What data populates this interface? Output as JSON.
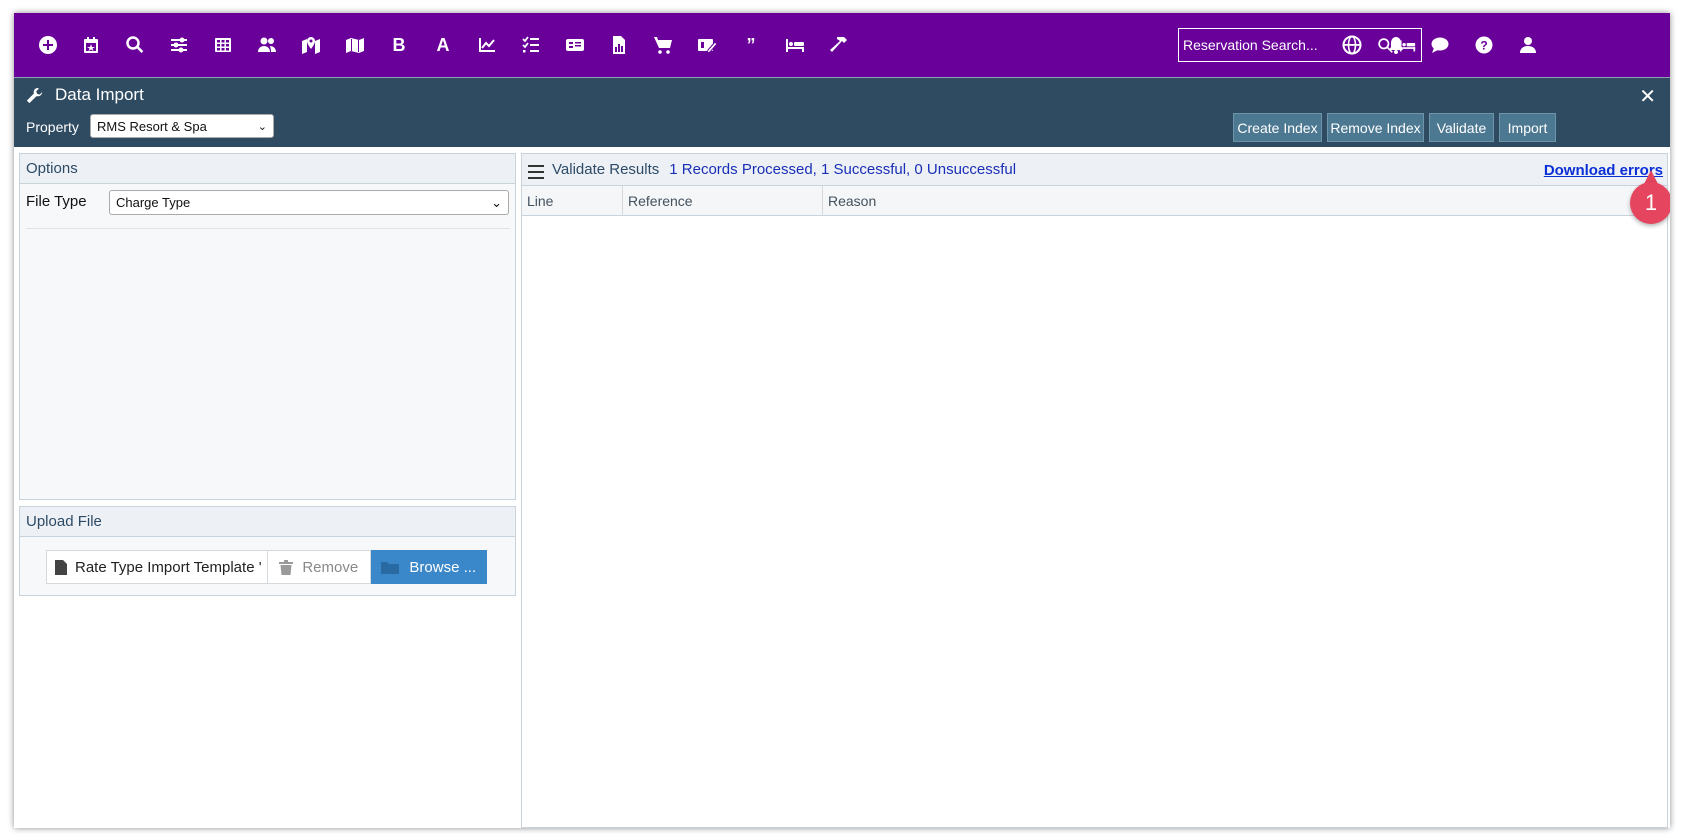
{
  "topnav": {
    "icons": [
      "add-icon",
      "calendar-icon",
      "search-icon",
      "sliders-icon",
      "grid-icon",
      "guests-icon",
      "map-marker-icon",
      "map-icon",
      "bold-b-icon",
      "letter-a-icon",
      "line-chart-icon",
      "checklist-icon",
      "id-card-icon",
      "report-icon",
      "cart-icon",
      "payment-icon",
      "quote-icon",
      "bed-icon",
      "hammer-icon"
    ],
    "bold_label": "B",
    "a_label": "A",
    "quote_label": "”",
    "search_placeholder": "Reservation Search...",
    "right_icons": [
      "globe-icon",
      "bell-icon",
      "chat-icon",
      "help-icon",
      "user-icon"
    ]
  },
  "header": {
    "title": "Data Import",
    "property_label": "Property",
    "property_value": "RMS Resort & Spa",
    "close": "✕",
    "buttons": {
      "create_index": "Create Index",
      "remove_index": "Remove Index",
      "validate": "Validate",
      "import": "Import"
    }
  },
  "options": {
    "title": "Options",
    "file_type_label": "File Type",
    "file_type_value": "Charge Type"
  },
  "upload": {
    "title": "Upload File",
    "file_name": "Rate Type Import Template '",
    "remove_label": "Remove",
    "browse_label": "Browse ..."
  },
  "results": {
    "title": "Validate Results",
    "summary": "1 Records Processed, 1 Successful, 0 Unsuccessful",
    "download_label": "Download errors",
    "columns": [
      "Line",
      "Reference",
      "Reason"
    ],
    "rows": []
  },
  "annotation": {
    "step_number": "1",
    "color": "#e5455e"
  },
  "colors": {
    "nav_bg": "#680099",
    "header_bg": "#2f4b62",
    "button_bg": "#4c7892",
    "browse_bg": "#3a87c9"
  }
}
